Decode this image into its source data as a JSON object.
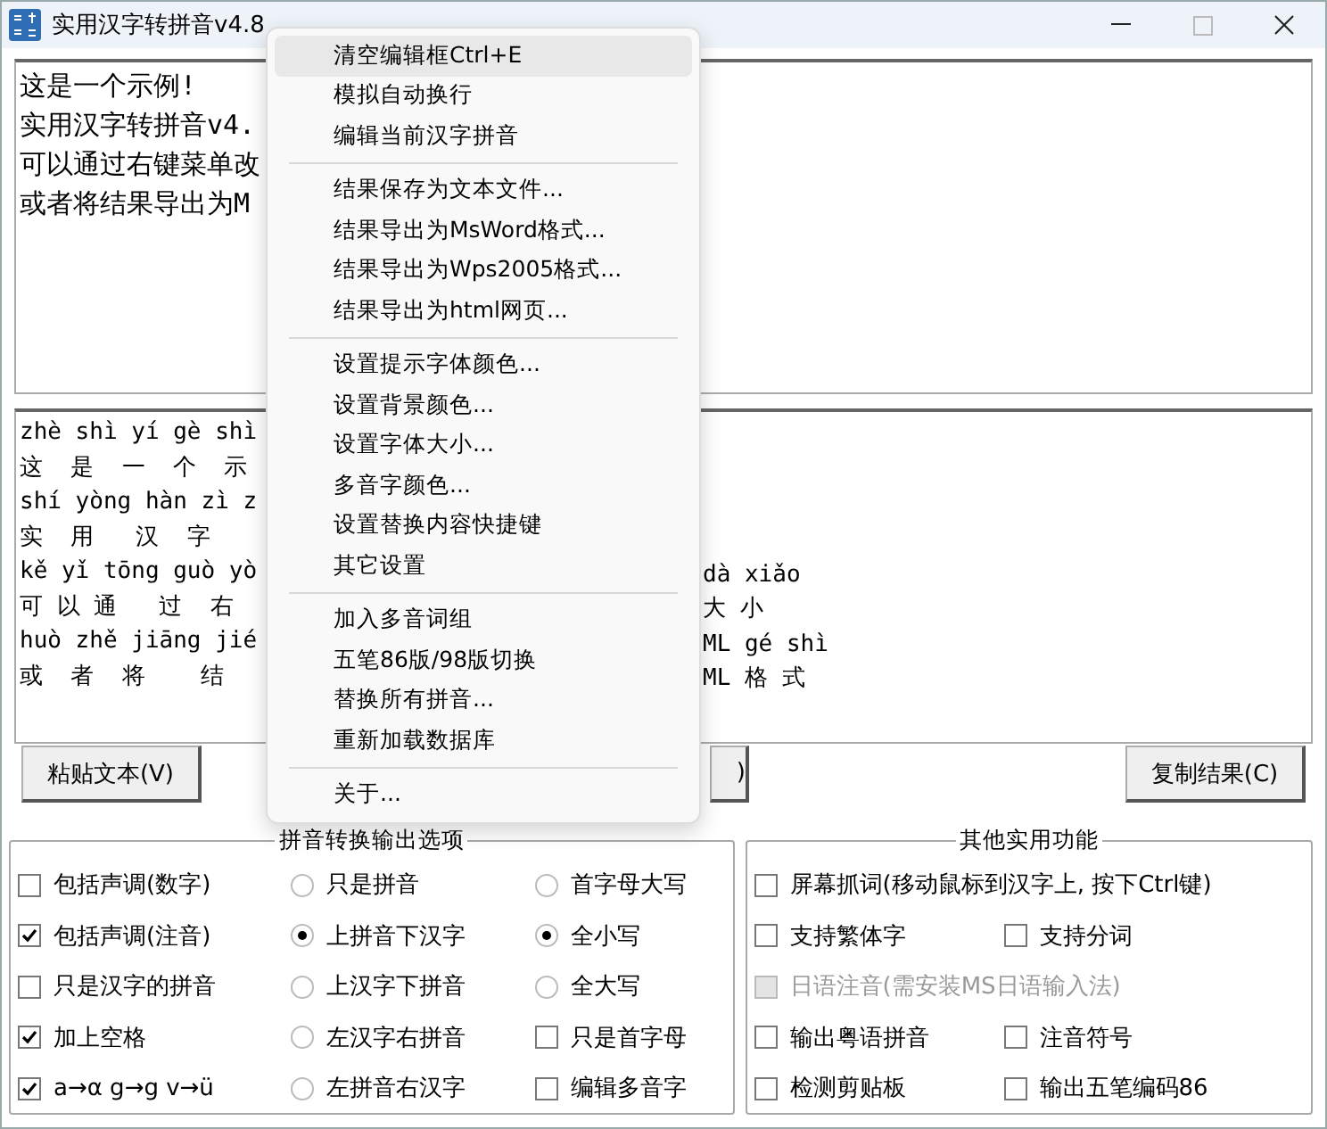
{
  "window": {
    "title": "实用汉字转拼音v4.8"
  },
  "input_box": {
    "lines": [
      "这是一个示例!",
      "实用汉字转拼音v4.",
      "可以通过右键菜单改",
      "或者将结果导出为M"
    ]
  },
  "output_box": {
    "lines": [
      {
        "left": "zhè shì yí gè shì"
      },
      {
        "left": "这  是  一  个  示"
      },
      {
        "left": "shí yòng hàn zì z"
      },
      {
        "left": "实  用   汉  字"
      },
      {
        "left": "kě yǐ tōng guò yò",
        "right": "dà xiǎo"
      },
      {
        "left": "可 以 通   过  右",
        "right": "大 小"
      },
      {
        "left": "huò zhě jiāng jié",
        "right": "ML gé shì"
      },
      {
        "left": "或  者  将    结",
        "right": "ML 格 式"
      }
    ]
  },
  "buttons": [
    {
      "label": "粘贴文本(V)"
    },
    {
      "label": ")"
    },
    {
      "label": "复制结果(C)"
    }
  ],
  "context_menu": {
    "groups": [
      [
        {
          "label": "清空编辑框Ctrl+E",
          "highlighted": true
        },
        {
          "label": "模拟自动换行",
          "highlighted": false
        },
        {
          "label": "编辑当前汉字拼音",
          "highlighted": false
        }
      ],
      [
        {
          "label": "结果保存为文本文件...",
          "highlighted": false
        },
        {
          "label": "结果导出为MsWord格式...",
          "highlighted": false
        },
        {
          "label": "结果导出为Wps2005格式...",
          "highlighted": false
        },
        {
          "label": "结果导出为html网页...",
          "highlighted": false
        }
      ],
      [
        {
          "label": "设置提示字体颜色...",
          "highlighted": false
        },
        {
          "label": "设置背景颜色...",
          "highlighted": false
        },
        {
          "label": "设置字体大小...",
          "highlighted": false
        },
        {
          "label": "多音字颜色...",
          "highlighted": false
        },
        {
          "label": "设置替换内容快捷键",
          "highlighted": false
        },
        {
          "label": "其它设置",
          "highlighted": false
        }
      ],
      [
        {
          "label": "加入多音词组",
          "highlighted": false
        },
        {
          "label": "五笔86版/98版切换",
          "highlighted": false
        },
        {
          "label": "替换所有拼音...",
          "highlighted": false
        },
        {
          "label": "重新加载数据库",
          "highlighted": false
        }
      ],
      [
        {
          "label": "关于...",
          "highlighted": false
        }
      ]
    ]
  },
  "pinyin_options": {
    "title": "拼音转换输出选项",
    "columns": [
      [
        {
          "kind": "checkbox",
          "label": "包括声调(数字)",
          "checked": false
        },
        {
          "kind": "checkbox",
          "label": "包括声调(注音)",
          "checked": true
        },
        {
          "kind": "checkbox",
          "label": "只是汉字的拼音",
          "checked": false
        },
        {
          "kind": "checkbox",
          "label": "加上空格",
          "checked": true
        },
        {
          "kind": "checkbox",
          "label": "a→α g→g v→ü",
          "checked": true
        }
      ],
      [
        {
          "kind": "radio",
          "label": "只是拼音",
          "checked": false
        },
        {
          "kind": "radio",
          "label": "上拼音下汉字",
          "checked": true
        },
        {
          "kind": "radio",
          "label": "上汉字下拼音",
          "checked": false
        },
        {
          "kind": "radio",
          "label": "左汉字右拼音",
          "checked": false
        },
        {
          "kind": "radio",
          "label": "左拼音右汉字",
          "checked": false
        }
      ],
      [
        {
          "kind": "radio",
          "label": "首字母大写",
          "checked": false
        },
        {
          "kind": "radio",
          "label": "全小写",
          "checked": true
        },
        {
          "kind": "radio",
          "label": "全大写",
          "checked": false
        },
        {
          "kind": "checkbox",
          "label": "只是首字母",
          "checked": false
        },
        {
          "kind": "checkbox",
          "label": "编辑多音字",
          "checked": false
        }
      ]
    ]
  },
  "other_functions": {
    "title": "其他实用功能",
    "rows": [
      [
        {
          "label": "屏幕抓词(移动鼠标到汉字上, 按下Ctrl键)",
          "checked": false,
          "disabled": false
        }
      ],
      [
        {
          "label": "支持繁体字",
          "checked": false,
          "disabled": false
        },
        {
          "label": "支持分词",
          "checked": false,
          "disabled": false
        }
      ],
      [
        {
          "label": "日语注音(需安装MS日语输入法)",
          "checked": false,
          "disabled": true
        }
      ],
      [
        {
          "label": "输出粤语拼音",
          "checked": false,
          "disabled": false
        },
        {
          "label": "注音符号",
          "checked": false,
          "disabled": false
        }
      ],
      [
        {
          "label": "检测剪贴板",
          "checked": false,
          "disabled": false
        },
        {
          "label": "输出五笔编码86",
          "checked": false,
          "disabled": false
        }
      ]
    ]
  }
}
